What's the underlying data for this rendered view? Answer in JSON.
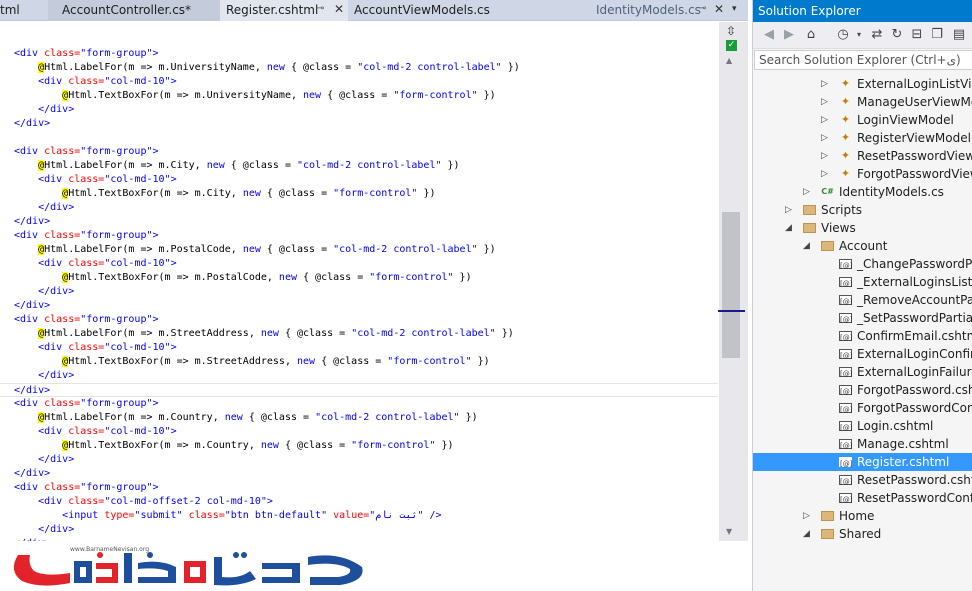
{
  "tabs": [
    {
      "label": "tml"
    },
    {
      "label": "AccountController.cs*"
    },
    {
      "label": "Register.cshtml"
    },
    {
      "label": "AccountViewModels.cs"
    },
    {
      "label": "IdentityModels.cs"
    }
  ],
  "code": [
    [],
    [
      [
        "t",
        "<div"
      ],
      [
        "a",
        " class="
      ],
      [
        "s",
        "\"form-group\""
      ],
      [
        "t",
        ">"
      ]
    ],
    [
      [
        "p",
        "    "
      ],
      [
        "r",
        "@"
      ],
      [
        "p",
        "Html.LabelFor(m => m.UniversityName, "
      ],
      [
        "k",
        "new"
      ],
      [
        "p",
        " { @class = "
      ],
      [
        "s",
        "\"col-md-2 control-label\""
      ],
      [
        "p",
        " })"
      ]
    ],
    [
      [
        "p",
        "    "
      ],
      [
        "t",
        "<div"
      ],
      [
        "a",
        " class="
      ],
      [
        "s",
        "\"col-md-10\""
      ],
      [
        "t",
        ">"
      ]
    ],
    [
      [
        "p",
        "        "
      ],
      [
        "r",
        "@"
      ],
      [
        "p",
        "Html.TextBoxFor(m => m.UniversityName, "
      ],
      [
        "k",
        "new"
      ],
      [
        "p",
        " { @class = "
      ],
      [
        "s",
        "\"form-control\""
      ],
      [
        "p",
        " })"
      ]
    ],
    [
      [
        "p",
        "    "
      ],
      [
        "t",
        "</div>"
      ]
    ],
    [
      [
        "t",
        "</div>"
      ]
    ],
    [],
    [
      [
        "t",
        "<div"
      ],
      [
        "a",
        " class="
      ],
      [
        "s",
        "\"form-group\""
      ],
      [
        "t",
        ">"
      ]
    ],
    [
      [
        "p",
        "    "
      ],
      [
        "r",
        "@"
      ],
      [
        "p",
        "Html.LabelFor(m => m.City, "
      ],
      [
        "k",
        "new"
      ],
      [
        "p",
        " { @class = "
      ],
      [
        "s",
        "\"col-md-2 control-label\""
      ],
      [
        "p",
        " })"
      ]
    ],
    [
      [
        "p",
        "    "
      ],
      [
        "t",
        "<div"
      ],
      [
        "a",
        " class="
      ],
      [
        "s",
        "\"col-md-10\""
      ],
      [
        "t",
        ">"
      ]
    ],
    [
      [
        "p",
        "        "
      ],
      [
        "r",
        "@"
      ],
      [
        "p",
        "Html.TextBoxFor(m => m.City, "
      ],
      [
        "k",
        "new"
      ],
      [
        "p",
        " { @class = "
      ],
      [
        "s",
        "\"form-control\""
      ],
      [
        "p",
        " })"
      ]
    ],
    [
      [
        "p",
        "    "
      ],
      [
        "t",
        "</div>"
      ]
    ],
    [
      [
        "t",
        "</div>"
      ]
    ],
    [
      [
        "t",
        "<div"
      ],
      [
        "a",
        " class="
      ],
      [
        "s",
        "\"form-group\""
      ],
      [
        "t",
        ">"
      ]
    ],
    [
      [
        "p",
        "    "
      ],
      [
        "r",
        "@"
      ],
      [
        "p",
        "Html.LabelFor(m => m.PostalCode, "
      ],
      [
        "k",
        "new"
      ],
      [
        "p",
        " { @class = "
      ],
      [
        "s",
        "\"col-md-2 control-label\""
      ],
      [
        "p",
        " })"
      ]
    ],
    [
      [
        "p",
        "    "
      ],
      [
        "t",
        "<div"
      ],
      [
        "a",
        " class="
      ],
      [
        "s",
        "\"col-md-10\""
      ],
      [
        "t",
        ">"
      ]
    ],
    [
      [
        "p",
        "        "
      ],
      [
        "r",
        "@"
      ],
      [
        "p",
        "Html.TextBoxFor(m => m.PostalCode, "
      ],
      [
        "k",
        "new"
      ],
      [
        "p",
        " { @class = "
      ],
      [
        "s",
        "\"form-control\""
      ],
      [
        "p",
        " })"
      ]
    ],
    [
      [
        "p",
        "    "
      ],
      [
        "t",
        "</div>"
      ]
    ],
    [
      [
        "t",
        "</div>"
      ]
    ],
    [
      [
        "t",
        "<div"
      ],
      [
        "a",
        " class="
      ],
      [
        "s",
        "\"form-group\""
      ],
      [
        "t",
        ">"
      ]
    ],
    [
      [
        "p",
        "    "
      ],
      [
        "r",
        "@"
      ],
      [
        "p",
        "Html.LabelFor(m => m.StreetAddress, "
      ],
      [
        "k",
        "new"
      ],
      [
        "p",
        " { @class = "
      ],
      [
        "s",
        "\"col-md-2 control-label\""
      ],
      [
        "p",
        " })"
      ]
    ],
    [
      [
        "p",
        "    "
      ],
      [
        "t",
        "<div"
      ],
      [
        "a",
        " class="
      ],
      [
        "s",
        "\"col-md-10\""
      ],
      [
        "t",
        ">"
      ]
    ],
    [
      [
        "p",
        "        "
      ],
      [
        "r",
        "@"
      ],
      [
        "p",
        "Html.TextBoxFor(m => m.StreetAddress, "
      ],
      [
        "k",
        "new"
      ],
      [
        "p",
        " { @class = "
      ],
      [
        "s",
        "\"form-control\""
      ],
      [
        "p",
        " })"
      ]
    ],
    [
      [
        "p",
        "    "
      ],
      [
        "t",
        "</div>"
      ]
    ],
    [
      [
        "t",
        "</div>"
      ]
    ],
    [
      [
        "t",
        "<div"
      ],
      [
        "a",
        " class="
      ],
      [
        "s",
        "\"form-group\""
      ],
      [
        "t",
        ">"
      ]
    ],
    [
      [
        "p",
        "    "
      ],
      [
        "r",
        "@"
      ],
      [
        "p",
        "Html.LabelFor(m => m.Country, "
      ],
      [
        "k",
        "new"
      ],
      [
        "p",
        " { @class = "
      ],
      [
        "s",
        "\"col-md-2 control-label\""
      ],
      [
        "p",
        " })"
      ]
    ],
    [
      [
        "p",
        "    "
      ],
      [
        "t",
        "<div"
      ],
      [
        "a",
        " class="
      ],
      [
        "s",
        "\"col-md-10\""
      ],
      [
        "t",
        ">"
      ]
    ],
    [
      [
        "p",
        "        "
      ],
      [
        "r",
        "@"
      ],
      [
        "p",
        "Html.TextBoxFor(m => m.Country, "
      ],
      [
        "k",
        "new"
      ],
      [
        "p",
        " { @class = "
      ],
      [
        "s",
        "\"form-control\""
      ],
      [
        "p",
        " })"
      ]
    ],
    [
      [
        "p",
        "    "
      ],
      [
        "t",
        "</div>"
      ]
    ],
    [
      [
        "t",
        "</div>"
      ]
    ],
    [
      [
        "t",
        "<div"
      ],
      [
        "a",
        " class="
      ],
      [
        "s",
        "\"form-group\""
      ],
      [
        "t",
        ">"
      ]
    ],
    [
      [
        "p",
        "    "
      ],
      [
        "t",
        "<div"
      ],
      [
        "a",
        " class="
      ],
      [
        "s",
        "\"col-md-offset-2 col-md-10\""
      ],
      [
        "t",
        ">"
      ]
    ],
    [
      [
        "p",
        "        "
      ],
      [
        "t",
        "<input"
      ],
      [
        "a",
        " type="
      ],
      [
        "s",
        "\"submit\""
      ],
      [
        "a",
        " class="
      ],
      [
        "s",
        "\"btn btn-default\""
      ],
      [
        "a",
        " value="
      ],
      [
        "s",
        "\"ثبت نام\""
      ],
      [
        "p",
        " "
      ],
      [
        "t",
        "/>"
      ]
    ],
    [
      [
        "p",
        "    "
      ],
      [
        "t",
        "</div>"
      ]
    ],
    [
      [
        "t",
        "</div>"
      ]
    ]
  ],
  "current_line": 25,
  "solution_explorer": {
    "title": "Solution Explorer",
    "search_placeholder": "Search Solution Explorer (Ctrl+ی)",
    "items": [
      {
        "label": "ExternalLoginListViewModel",
        "level": 3,
        "arrow": "right",
        "icon": "property"
      },
      {
        "label": "ManageUserViewModel",
        "level": 3,
        "arrow": "right",
        "icon": "property"
      },
      {
        "label": "LoginViewModel",
        "level": 3,
        "arrow": "right",
        "icon": "property"
      },
      {
        "label": "RegisterViewModel",
        "level": 3,
        "arrow": "right",
        "icon": "property"
      },
      {
        "label": "ResetPasswordViewModel",
        "level": 3,
        "arrow": "right",
        "icon": "property"
      },
      {
        "label": "ForgotPasswordViewModel",
        "level": 3,
        "arrow": "right",
        "icon": "property"
      },
      {
        "label": "IdentityModels.cs",
        "level": 2,
        "arrow": "right",
        "icon": "csharp"
      },
      {
        "label": "Scripts",
        "level": 1,
        "arrow": "right",
        "icon": "folder"
      },
      {
        "label": "Views",
        "level": 1,
        "arrow": "down",
        "icon": "folder"
      },
      {
        "label": "Account",
        "level": 2,
        "arrow": "down",
        "icon": "folder"
      },
      {
        "label": "_ChangePasswordPartial.cshtml",
        "level": 3,
        "arrow": "",
        "icon": "razor"
      },
      {
        "label": "_ExternalLoginsListPartial.cshtml",
        "level": 3,
        "arrow": "",
        "icon": "razor"
      },
      {
        "label": "_RemoveAccountPartial.cshtml",
        "level": 3,
        "arrow": "",
        "icon": "razor"
      },
      {
        "label": "_SetPasswordPartial.cshtml",
        "level": 3,
        "arrow": "",
        "icon": "razor"
      },
      {
        "label": "ConfirmEmail.cshtml",
        "level": 3,
        "arrow": "",
        "icon": "razor"
      },
      {
        "label": "ExternalLoginConfirmation.cshtml",
        "level": 3,
        "arrow": "",
        "icon": "razor"
      },
      {
        "label": "ExternalLoginFailure.cshtml",
        "level": 3,
        "arrow": "",
        "icon": "razor"
      },
      {
        "label": "ForgotPassword.cshtml",
        "level": 3,
        "arrow": "",
        "icon": "razor"
      },
      {
        "label": "ForgotPasswordConfirmation.cshtml",
        "level": 3,
        "arrow": "",
        "icon": "razor"
      },
      {
        "label": "Login.cshtml",
        "level": 3,
        "arrow": "",
        "icon": "razor"
      },
      {
        "label": "Manage.cshtml",
        "level": 3,
        "arrow": "",
        "icon": "razor"
      },
      {
        "label": "Register.cshtml",
        "level": 3,
        "arrow": "",
        "icon": "razor",
        "selected": true
      },
      {
        "label": "ResetPassword.cshtml",
        "level": 3,
        "arrow": "",
        "icon": "razor"
      },
      {
        "label": "ResetPasswordConfirmation.cshtml",
        "level": 3,
        "arrow": "",
        "icon": "razor"
      },
      {
        "label": "Home",
        "level": 2,
        "arrow": "right",
        "icon": "folder"
      },
      {
        "label": "Shared",
        "level": 2,
        "arrow": "down",
        "icon": "folder"
      }
    ]
  },
  "logo": {
    "url": "www.BarnameNevisan.org",
    "text": "برنامه نویسان",
    "colors": {
      "red": "#e2232a",
      "blue": "#1d4f9c"
    }
  },
  "colors": {
    "accent": "#007acc",
    "selection": "#3399ff",
    "tag": "#0000ff",
    "attribute": "#ff0000",
    "razor_highlight": "#ffff00"
  }
}
